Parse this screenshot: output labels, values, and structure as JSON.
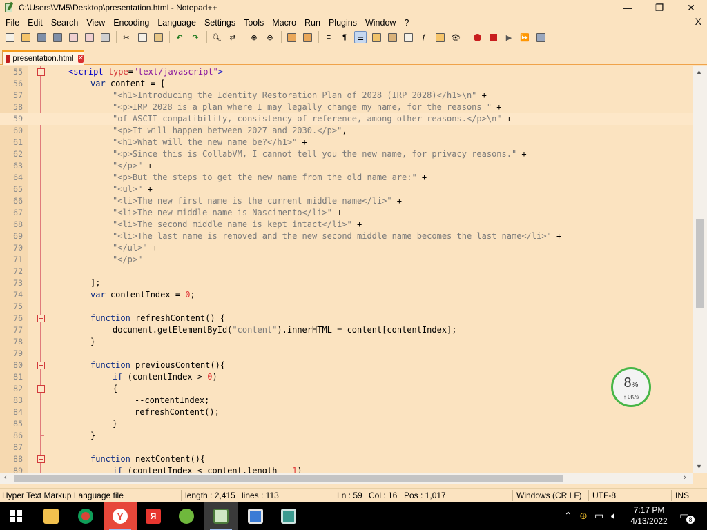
{
  "window": {
    "title": "C:\\Users\\VM5\\Desktop\\presentation.html - Notepad++",
    "minimize": "—",
    "maximize": "❐",
    "close": "✕"
  },
  "menu": {
    "items": [
      "File",
      "Edit",
      "Search",
      "View",
      "Encoding",
      "Language",
      "Settings",
      "Tools",
      "Macro",
      "Run",
      "Plugins",
      "Window",
      "?"
    ],
    "close_doc": "X"
  },
  "tab": {
    "label": "presentation.html",
    "close": "✕"
  },
  "editor": {
    "current_line": 59,
    "lines": [
      {
        "n": "55",
        "fold": "open",
        "html": "<span class=\"tag\">&lt;script</span> <span class=\"attr\">type</span>=<span class=\"aval\">\"text/javascript\"</span><span class=\"tag\">&gt;</span>",
        "indent": 2
      },
      {
        "n": "56",
        "html": "<span class=\"kw\">var</span> content = [",
        "indent": 4
      },
      {
        "n": "57",
        "html": "<span class=\"str\">\"&lt;h1&gt;Introducing the Identity Restoration Plan of 2028 (IRP 2028)&lt;/h1&gt;\\n\"</span> +",
        "indent": 6
      },
      {
        "n": "58",
        "html": "<span class=\"str\">\"&lt;p&gt;IRP 2028 is a plan where I may legally change my name, for the reasons \"</span> +",
        "indent": 6
      },
      {
        "n": "59",
        "html": "<span class=\"str\">\"of ASCII compatibility, consistency of reference, among other reasons.&lt;/p&gt;\\n\"</span> +",
        "indent": 6
      },
      {
        "n": "60",
        "html": "<span class=\"str\">\"&lt;p&gt;It will happen between 2027 and 2030.&lt;/p&gt;\"</span>,",
        "indent": 6
      },
      {
        "n": "61",
        "html": "<span class=\"str\">\"&lt;h1&gt;What will the new name be?&lt;/h1&gt;\"</span> +",
        "indent": 6
      },
      {
        "n": "62",
        "html": "<span class=\"str\">\"&lt;p&gt;Since this is CollabVM, I cannot tell you the new name, for privacy reasons.\"</span> +",
        "indent": 6
      },
      {
        "n": "63",
        "html": "<span class=\"str\">\"&lt;/p&gt;\"</span> +",
        "indent": 6
      },
      {
        "n": "64",
        "html": "<span class=\"str\">\"&lt;p&gt;But the steps to get the new name from the old name are:\"</span> +",
        "indent": 6
      },
      {
        "n": "65",
        "html": "<span class=\"str\">\"&lt;ul&gt;\"</span> +",
        "indent": 6
      },
      {
        "n": "66",
        "html": "<span class=\"str\">\"&lt;li&gt;The new first name is the current middle name&lt;/li&gt;\"</span> +",
        "indent": 6
      },
      {
        "n": "67",
        "html": "<span class=\"str\">\"&lt;li&gt;The new middle name is Nascimento&lt;/li&gt;\"</span> +",
        "indent": 6
      },
      {
        "n": "68",
        "html": "<span class=\"str\">\"&lt;li&gt;The second middle name is kept intact&lt;/li&gt;\"</span> +",
        "indent": 6
      },
      {
        "n": "69",
        "html": "<span class=\"str\">\"&lt;li&gt;The last name is removed and the new second middle name becomes the last name&lt;/li&gt;\"</span> +",
        "indent": 6
      },
      {
        "n": "70",
        "html": "<span class=\"str\">\"&lt;/ul&gt;\"</span> +",
        "indent": 6
      },
      {
        "n": "71",
        "html": "<span class=\"str\">\"&lt;/p&gt;\"</span>",
        "indent": 6
      },
      {
        "n": "72",
        "html": "",
        "indent": 0
      },
      {
        "n": "73",
        "html": "];",
        "indent": 4
      },
      {
        "n": "74",
        "html": "<span class=\"kw\">var</span> contentIndex = <span class=\"num\">0</span>;",
        "indent": 4
      },
      {
        "n": "75",
        "html": "",
        "indent": 0
      },
      {
        "n": "76",
        "fold": "open",
        "html": "<span class=\"kw\">function</span> refreshContent() {",
        "indent": 4
      },
      {
        "n": "77",
        "html": "document.getElementById(<span class=\"str\">\"content\"</span>).innerHTML = content[contentIndex];",
        "indent": 6
      },
      {
        "n": "78",
        "fold": "end",
        "html": "}",
        "indent": 4
      },
      {
        "n": "79",
        "html": "",
        "indent": 0
      },
      {
        "n": "80",
        "fold": "open",
        "html": "<span class=\"kw\">function</span> previousContent(){",
        "indent": 4
      },
      {
        "n": "81",
        "html": "<span class=\"kw\">if</span> (contentIndex &gt; <span class=\"num\">0</span>)",
        "indent": 6
      },
      {
        "n": "82",
        "fold": "open",
        "html": "{",
        "indent": 6
      },
      {
        "n": "83",
        "html": "--contentIndex;",
        "indent": 8
      },
      {
        "n": "84",
        "html": "refreshContent();",
        "indent": 8
      },
      {
        "n": "85",
        "fold": "end",
        "html": "}",
        "indent": 6
      },
      {
        "n": "86",
        "fold": "end",
        "html": "}",
        "indent": 4
      },
      {
        "n": "87",
        "html": "",
        "indent": 0
      },
      {
        "n": "88",
        "fold": "open",
        "html": "<span class=\"kw\">function</span> nextContent(){",
        "indent": 4
      },
      {
        "n": "89",
        "html": "<span class=\"kw\">if</span> (contentIndex &lt; content.length - <span class=\"num\">1</span>)",
        "indent": 6
      }
    ]
  },
  "status": {
    "language": "Hyper Text Markup Language file",
    "length": "length : 2,415",
    "lines": "lines : 113",
    "ln": "Ln : 59",
    "col": "Col : 16",
    "pos": "Pos : 1,017",
    "eol": "Windows (CR LF)",
    "encoding": "UTF-8",
    "mode": "INS"
  },
  "netmon": {
    "percent": "8",
    "percent_sign": "%",
    "rate": "↑  0K/s"
  },
  "taskbar": {
    "time": "7:17 PM",
    "date": "4/13/2022",
    "notifications": "8"
  },
  "colors": {
    "background": "#fbe3c0",
    "keyword": "#0a2a84",
    "string": "#7a7a7a",
    "number": "#e03a3a",
    "accent": "#f59c1e"
  }
}
